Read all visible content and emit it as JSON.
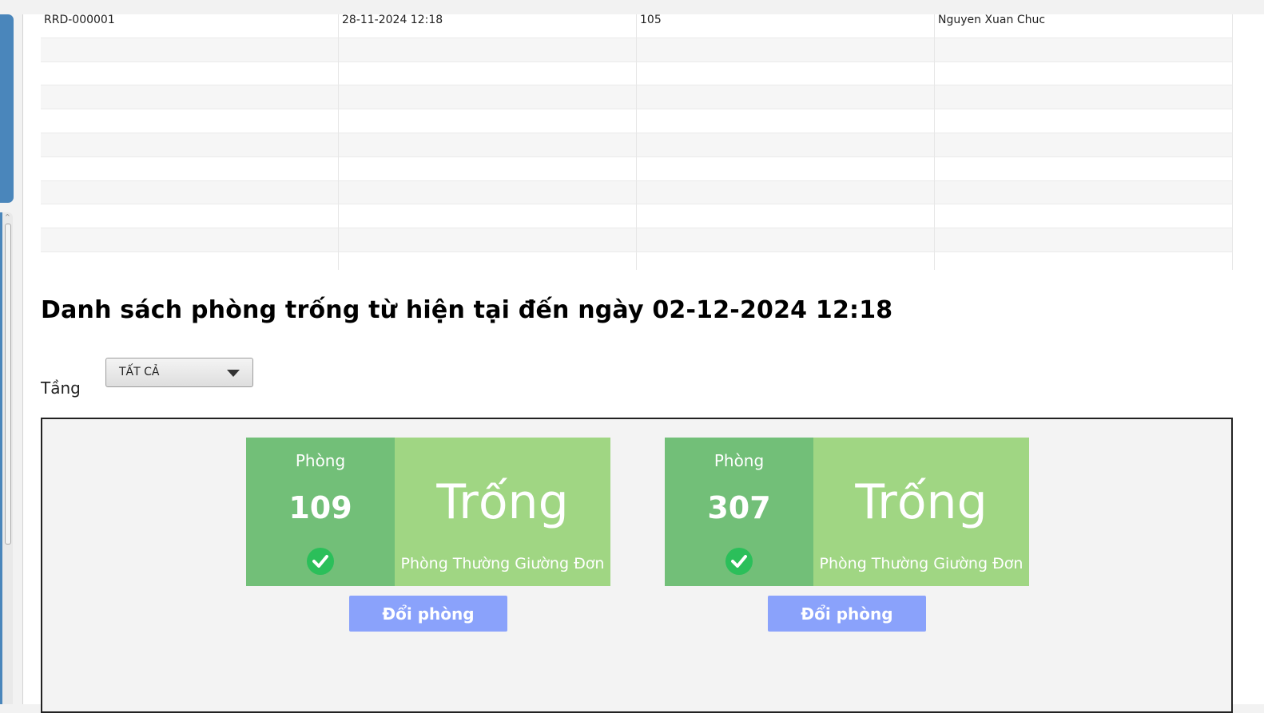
{
  "table": {
    "rows": [
      [
        "RRD-000001",
        "28-11-2024 12:18",
        "105",
        "Nguyen Xuan Chuc"
      ],
      [
        "",
        "",
        "",
        ""
      ],
      [
        "",
        "",
        "",
        ""
      ],
      [
        "",
        "",
        "",
        ""
      ],
      [
        "",
        "",
        "",
        ""
      ],
      [
        "",
        "",
        "",
        ""
      ],
      [
        "",
        "",
        "",
        ""
      ],
      [
        "",
        "",
        "",
        ""
      ],
      [
        "",
        "",
        "",
        ""
      ],
      [
        "",
        "",
        "",
        ""
      ],
      [
        "",
        "",
        "",
        ""
      ]
    ]
  },
  "section": {
    "title": "Danh sách phòng trống từ hiện tại đến ngày 02-12-2024 12:18"
  },
  "filter": {
    "floor_label": "Tầng",
    "floor_value": "TẤT CẢ"
  },
  "rooms": [
    {
      "phong_label": "Phòng",
      "number": "109",
      "status": "Trống",
      "type": "Phòng Thường Giường Đơn",
      "button": "Đổi phòng",
      "status_color": "#a0d683",
      "number_color": "#72bf78"
    },
    {
      "phong_label": "Phòng",
      "number": "307",
      "status": "Trống",
      "type": "Phòng Thường Giường Đơn",
      "button": "Đổi phòng",
      "status_color": "#a0d683",
      "number_color": "#72bf78"
    }
  ],
  "colors": {
    "button": "#8aa2fb",
    "check": "#2bbf5a",
    "sidebar": "#4a86bb"
  }
}
